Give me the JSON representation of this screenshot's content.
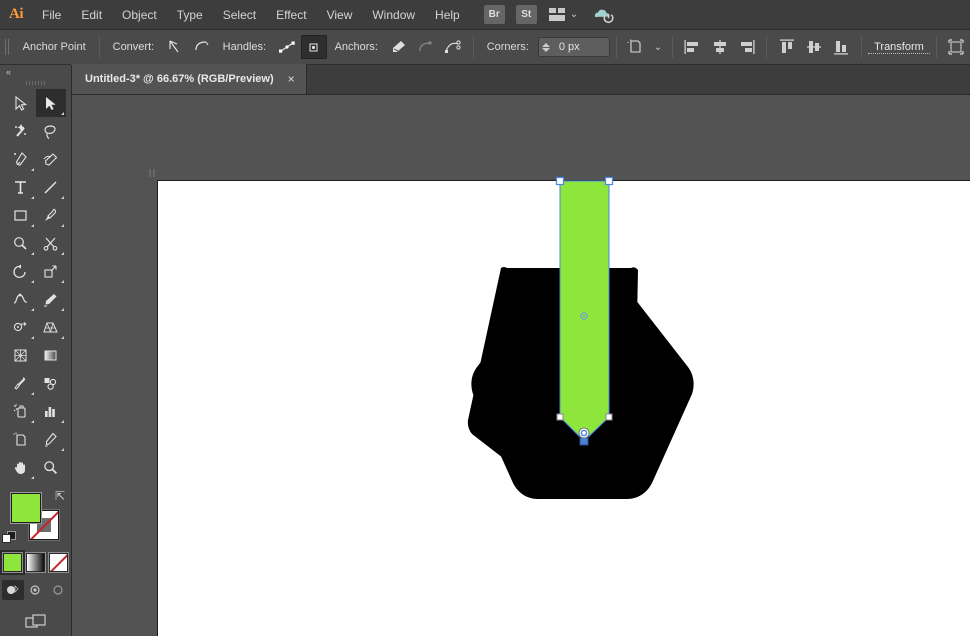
{
  "app": {
    "name": "Adobe Illustrator",
    "logo_text": "Ai"
  },
  "menubar": {
    "items": [
      {
        "label": "File"
      },
      {
        "label": "Edit"
      },
      {
        "label": "Object"
      },
      {
        "label": "Type"
      },
      {
        "label": "Select"
      },
      {
        "label": "Effect"
      },
      {
        "label": "View"
      },
      {
        "label": "Window"
      },
      {
        "label": "Help"
      }
    ],
    "bridge_button": "Br",
    "stock_button": "St",
    "arrange_icon": "arrange-documents-icon",
    "chevron": "⌄",
    "cc_icon": "creative-cloud-sync-icon"
  },
  "controlbar": {
    "title": "Anchor Point",
    "convert_label": "Convert:",
    "convert_icons": [
      {
        "name": "convert-to-corner-icon",
        "active": false
      },
      {
        "name": "convert-to-smooth-icon",
        "active": false
      }
    ],
    "handles_label": "Handles:",
    "handles_icons": [
      {
        "name": "show-handles-icon",
        "active": false
      },
      {
        "name": "hide-handles-icon",
        "active": true
      }
    ],
    "anchors_label": "Anchors:",
    "anchors_icons": [
      {
        "name": "remove-selected-anchors-icon",
        "active": false,
        "dim": false
      },
      {
        "name": "connect-selected-endpoints-icon",
        "active": false,
        "dim": true
      },
      {
        "name": "cut-path-at-anchors-icon",
        "active": false,
        "dim": false
      }
    ],
    "corners_label": "Corners:",
    "corners_value": "0 px",
    "isolate_icon": "isolate-selected-object-icon",
    "align_horizontal_icons": [
      {
        "name": "horizontal-align-left-icon"
      },
      {
        "name": "horizontal-align-center-icon"
      },
      {
        "name": "horizontal-align-right-icon"
      }
    ],
    "align_vertical_icons": [
      {
        "name": "vertical-align-top-icon"
      },
      {
        "name": "vertical-align-center-icon"
      },
      {
        "name": "vertical-align-bottom-icon"
      }
    ],
    "transform_label": "Transform",
    "bounds_icon": "transform-bounding-box-icon"
  },
  "tabbar": {
    "document_title": "Untitled-3* @ 66.67% (RGB/Preview)",
    "close_label": "×"
  },
  "toolpanel": {
    "collapse_icon": "collapse-panel-icon",
    "collapse_label": "«",
    "tools": [
      {
        "name": "selection-tool",
        "selected": false,
        "flyout": false
      },
      {
        "name": "direct-selection-tool",
        "selected": true,
        "flyout": true
      },
      {
        "name": "magic-wand-tool",
        "selected": false,
        "flyout": false
      },
      {
        "name": "lasso-tool",
        "selected": false,
        "flyout": false
      },
      {
        "name": "pen-tool",
        "selected": false,
        "flyout": true
      },
      {
        "name": "curvature-tool",
        "selected": false,
        "flyout": false
      },
      {
        "name": "type-tool",
        "selected": false,
        "flyout": true
      },
      {
        "name": "line-segment-tool",
        "selected": false,
        "flyout": true
      },
      {
        "name": "rectangle-tool",
        "selected": false,
        "flyout": true
      },
      {
        "name": "paintbrush-tool",
        "selected": false,
        "flyout": true
      },
      {
        "name": "shaper-tool",
        "selected": false,
        "flyout": true
      },
      {
        "name": "scissors-tool",
        "selected": false,
        "flyout": true
      },
      {
        "name": "rotate-tool",
        "selected": false,
        "flyout": true
      },
      {
        "name": "scale-tool",
        "selected": false,
        "flyout": true
      },
      {
        "name": "width-tool",
        "selected": false,
        "flyout": true
      },
      {
        "name": "free-transform-tool",
        "selected": false,
        "flyout": true
      },
      {
        "name": "shape-builder-tool",
        "selected": false,
        "flyout": true
      },
      {
        "name": "perspective-grid-tool",
        "selected": false,
        "flyout": true
      },
      {
        "name": "mesh-tool",
        "selected": false,
        "flyout": false
      },
      {
        "name": "gradient-tool",
        "selected": false,
        "flyout": false
      },
      {
        "name": "eyedropper-tool",
        "selected": false,
        "flyout": true
      },
      {
        "name": "blend-tool",
        "selected": false,
        "flyout": false
      },
      {
        "name": "symbol-sprayer-tool",
        "selected": false,
        "flyout": true
      },
      {
        "name": "column-graph-tool",
        "selected": false,
        "flyout": true
      },
      {
        "name": "artboard-tool",
        "selected": false,
        "flyout": false
      },
      {
        "name": "slice-tool",
        "selected": false,
        "flyout": true
      },
      {
        "name": "hand-tool",
        "selected": false,
        "flyout": true
      },
      {
        "name": "zoom-tool",
        "selected": false,
        "flyout": false
      }
    ],
    "fill_color": "#8ee63c",
    "stroke_color": "none",
    "swap_icon": "swap-fill-stroke-icon",
    "default_icon": "default-fill-stroke-icon",
    "fill_types": [
      {
        "name": "color-fill-button",
        "selected": true
      },
      {
        "name": "gradient-fill-button",
        "selected": false
      },
      {
        "name": "none-fill-button",
        "selected": false
      }
    ],
    "draw_modes": [
      {
        "name": "draw-normal-button",
        "selected": true
      },
      {
        "name": "draw-behind-button",
        "selected": false
      },
      {
        "name": "draw-inside-button",
        "selected": false
      }
    ],
    "screen_mode": {
      "name": "change-screen-mode-button"
    }
  },
  "canvas": {
    "zoom_percent": "66.67%",
    "color_mode": "RGB/Preview",
    "artboard_background": "#ffffff",
    "shapes": [
      {
        "name": "black-polygon-shape",
        "fill": "#000000",
        "description": "rounded hexagonal body"
      },
      {
        "name": "green-arrow-shape",
        "fill": "#8ee63c",
        "description": "vertical bar with pointed bottom"
      }
    ],
    "selection": {
      "anchor_color": "#4a86e8",
      "selected_anchor": "bottom-point",
      "anchors": [
        {
          "name": "anchor-top-left",
          "selected": false
        },
        {
          "name": "anchor-top-right",
          "selected": false
        },
        {
          "name": "anchor-shoulder-left",
          "selected": false
        },
        {
          "name": "anchor-shoulder-right",
          "selected": false
        },
        {
          "name": "anchor-bottom-point",
          "selected": true
        }
      ],
      "center_points": [
        {
          "name": "center-point-upper"
        },
        {
          "name": "center-point-lower"
        }
      ]
    }
  }
}
